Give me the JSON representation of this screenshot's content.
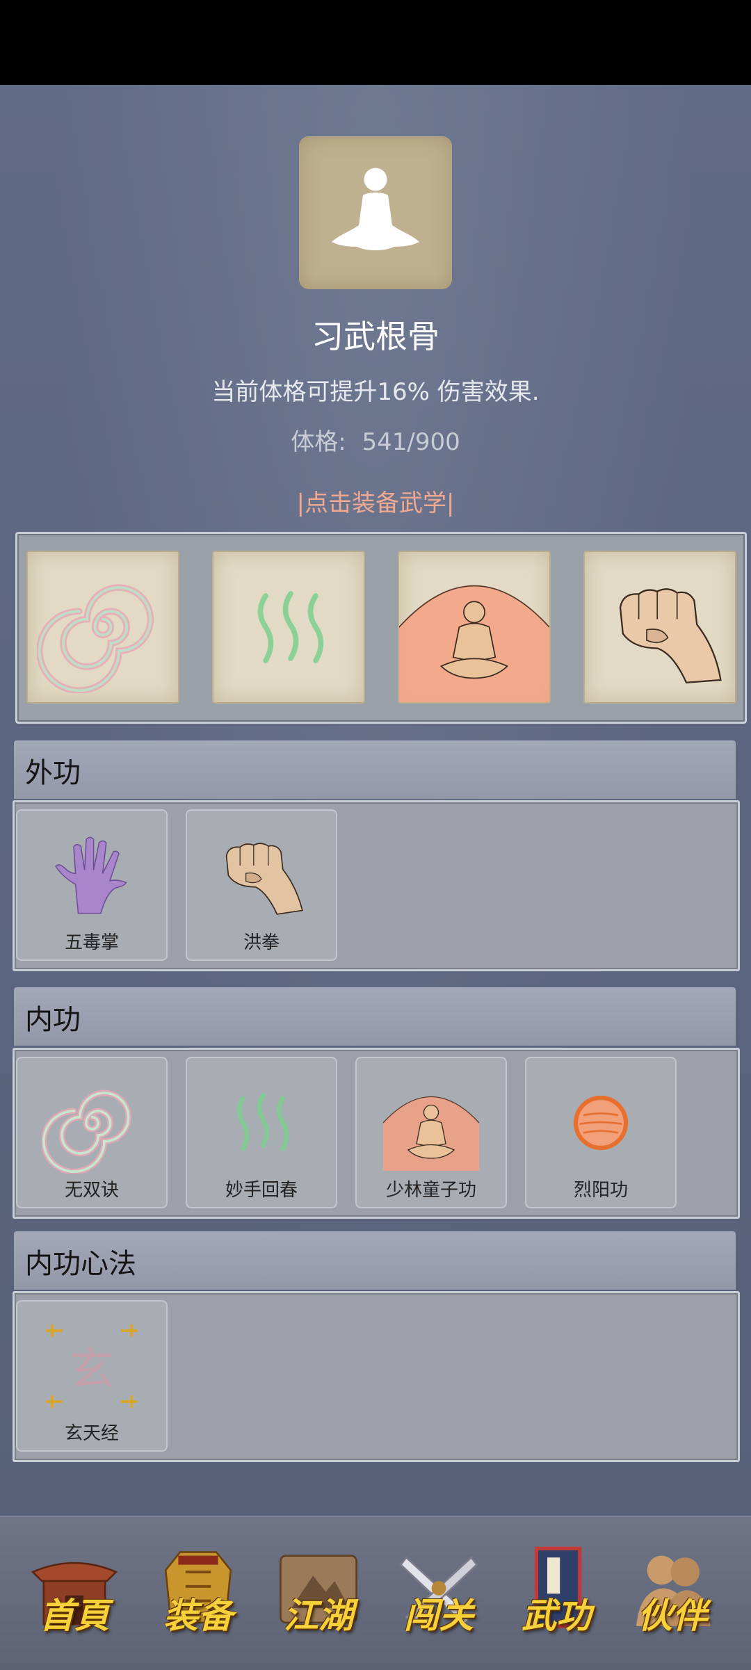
{
  "header": {
    "title": "习武根骨",
    "description": "当前体格可提升16% 伤害效果.",
    "stat_label": "体格:",
    "stat_value": "541/900",
    "equip_hint": "|点击装备武学|"
  },
  "equipped": [
    {
      "icon": "swirl-icon"
    },
    {
      "icon": "green-waves-icon"
    },
    {
      "icon": "meditating-monk-icon"
    },
    {
      "icon": "fist-icon"
    }
  ],
  "sections": [
    {
      "title": "外功",
      "skills": [
        {
          "label": "五毒掌",
          "icon": "purple-palm-icon"
        },
        {
          "label": "洪拳",
          "icon": "fist-icon"
        }
      ]
    },
    {
      "title": "内功",
      "skills": [
        {
          "label": "无双诀",
          "icon": "swirl-icon"
        },
        {
          "label": "妙手回春",
          "icon": "green-waves-icon"
        },
        {
          "label": "少林童子功",
          "icon": "meditating-monk-icon"
        },
        {
          "label": "烈阳功",
          "icon": "orange-sun-icon"
        }
      ]
    },
    {
      "title": "内功心法",
      "skills": [
        {
          "label": "玄天经",
          "icon": "scroll-xuan-icon",
          "icon_text": "玄"
        }
      ]
    }
  ],
  "nav": [
    {
      "label": "首頁",
      "icon": "temple-icon"
    },
    {
      "label": "装备",
      "icon": "armor-icon"
    },
    {
      "label": "江湖",
      "icon": "map-scroll-icon"
    },
    {
      "label": "闯关",
      "icon": "crossed-swords-icon"
    },
    {
      "label": "武功",
      "icon": "martial-book-icon",
      "active": true
    },
    {
      "label": "伙伴",
      "icon": "companions-icon"
    }
  ],
  "colors": {
    "background": "#5d6680",
    "accent_text": "#f2a992",
    "nav_label": "#f6d13a"
  }
}
